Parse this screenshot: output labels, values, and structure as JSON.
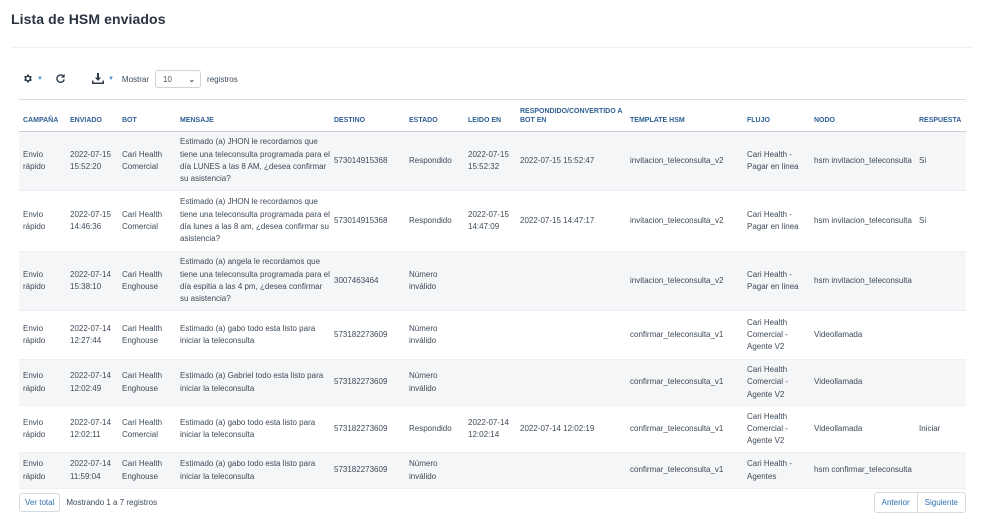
{
  "page": {
    "title": "Lista de HSM enviados"
  },
  "toolbar": {
    "mostrar_label": "Mostrar",
    "page_size": "10",
    "registros_label": "registros"
  },
  "table": {
    "headers": [
      "CAMPAÑA",
      "ENVIADO",
      "BOT",
      "MENSAJE",
      "DESTINO",
      "ESTADO",
      "LEIDO EN",
      "RESPONDIDO/CONVERTIDO A BOT EN",
      "TEMPLATE HSM",
      "FLUJO",
      "NODO",
      "RESPUESTA"
    ],
    "rows": [
      [
        "Envio rápido",
        "2022-07-15 15:52:20",
        "Cari Health Comercial",
        "Estimado (a) JHON le recordamos que tiene una teleconsulta programada para el día LUNES a las 8 AM, ¿desea confirmar su asistencia?",
        "573014915368",
        "Respondido",
        "2022-07-15 15:52:32",
        "2022-07-15 15:52:47",
        "invitacion_teleconsulta_v2",
        "Cari Health - Pagar en linea",
        "hsm invitacion_teleconsulta",
        "Si"
      ],
      [
        "Envio rápido",
        "2022-07-15 14:46:36",
        "Cari Health Comercial",
        "Estimado (a) JHON le recordamos que tiene una teleconsulta programada para el día lunes a las 8 am, ¿desea confirmar su asistencia?",
        "573014915368",
        "Respondido",
        "2022-07-15 14:47:09",
        "2022-07-15 14:47:17",
        "invitacion_teleconsulta_v2",
        "Cari Health - Pagar en linea",
        "hsm invitacion_teleconsulta",
        "Si"
      ],
      [
        "Envio rápido",
        "2022-07-14 15:38:10",
        "Cari Health Enghouse",
        "Estimado (a) angela le recordamos que tiene una teleconsulta programada para el día espitia a las 4 pm, ¿desea confirmar su asistencia?",
        "3007463464",
        "Número inválido",
        "",
        "",
        "invitacion_teleconsulta_v2",
        "Cari Health - Pagar en linea",
        "hsm invitacion_teleconsulta",
        ""
      ],
      [
        "Envio rápido",
        "2022-07-14 12:27:44",
        "Cari Health Enghouse",
        "Estimado (a) gabo todo esta listo para iniciar la teleconsulta",
        "573182273609",
        "Número inválido",
        "",
        "",
        "confirmar_teleconsulta_v1",
        "Cari Health Comercial - Agente V2",
        "Videollamada",
        ""
      ],
      [
        "Envio rápido",
        "2022-07-14 12:02:49",
        "Cari Health Enghouse",
        "Estimado (a) Gabriel todo esta listo para iniciar la teleconsulta",
        "573182273609",
        "Número inválido",
        "",
        "",
        "confirmar_teleconsulta_v1",
        "Cari Health Comercial - Agente V2",
        "Videollamada",
        ""
      ],
      [
        "Envio rápido",
        "2022-07-14 12:02:11",
        "Cari Health Comercial",
        "Estimado (a) gabo todo esta listo para iniciar la teleconsulta",
        "573182273609",
        "Respondido",
        "2022-07-14 12:02:14",
        "2022-07-14 12:02:19",
        "confirmar_teleconsulta_v1",
        "Cari Health Comercial - Agente V2",
        "Videollamada",
        "Iniciar"
      ],
      [
        "Envio rápido",
        "2022-07-14 11:59:04",
        "Cari Health Enghouse",
        "Estimado (a) gabo todo esta listo para iniciar la teleconsulta",
        "573182273609",
        "Número inválido",
        "",
        "",
        "confirmar_teleconsulta_v1",
        "Cari Health - Agentes",
        "hsm confirmar_teleconsulta",
        ""
      ]
    ]
  },
  "footer": {
    "ver_total": "Ver total",
    "summary": "Mostrando 1 a 7 registros",
    "prev": "Anterior",
    "next": "Siguiente"
  },
  "colors": {
    "accent": "#2f6fb0",
    "header_text": "#2f5f93",
    "stripe": "#f5f6f8"
  },
  "icons": [
    "gear-icon",
    "refresh-icon",
    "download-icon",
    "chevron-down-icon"
  ]
}
